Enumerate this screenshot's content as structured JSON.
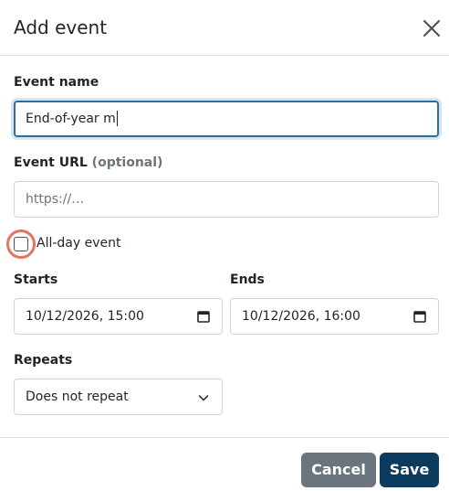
{
  "dialog": {
    "title": "Add event"
  },
  "form": {
    "event_name": {
      "label": "Event name",
      "value": "End-of-year m"
    },
    "event_url": {
      "label": "Event URL",
      "label_hint": "(optional)",
      "placeholder": "https://…"
    },
    "all_day": {
      "label": "All-day event",
      "checked": false
    },
    "starts": {
      "label": "Starts",
      "value": "10/12/2026, 15:00"
    },
    "ends": {
      "label": "Ends",
      "value": "10/12/2026, 16:00"
    },
    "repeats": {
      "label": "Repeats",
      "value": "Does not repeat"
    }
  },
  "footer": {
    "cancel_label": "Cancel",
    "save_label": "Save"
  },
  "icons": {
    "close": "close-icon",
    "calendar": "calendar-icon",
    "chevron": "chevron-down-icon"
  },
  "colors": {
    "primary": "#0d3b5e",
    "secondary": "#6c757d",
    "focus_border": "#2f6f9f",
    "highlight_ring": "#e8735f"
  }
}
